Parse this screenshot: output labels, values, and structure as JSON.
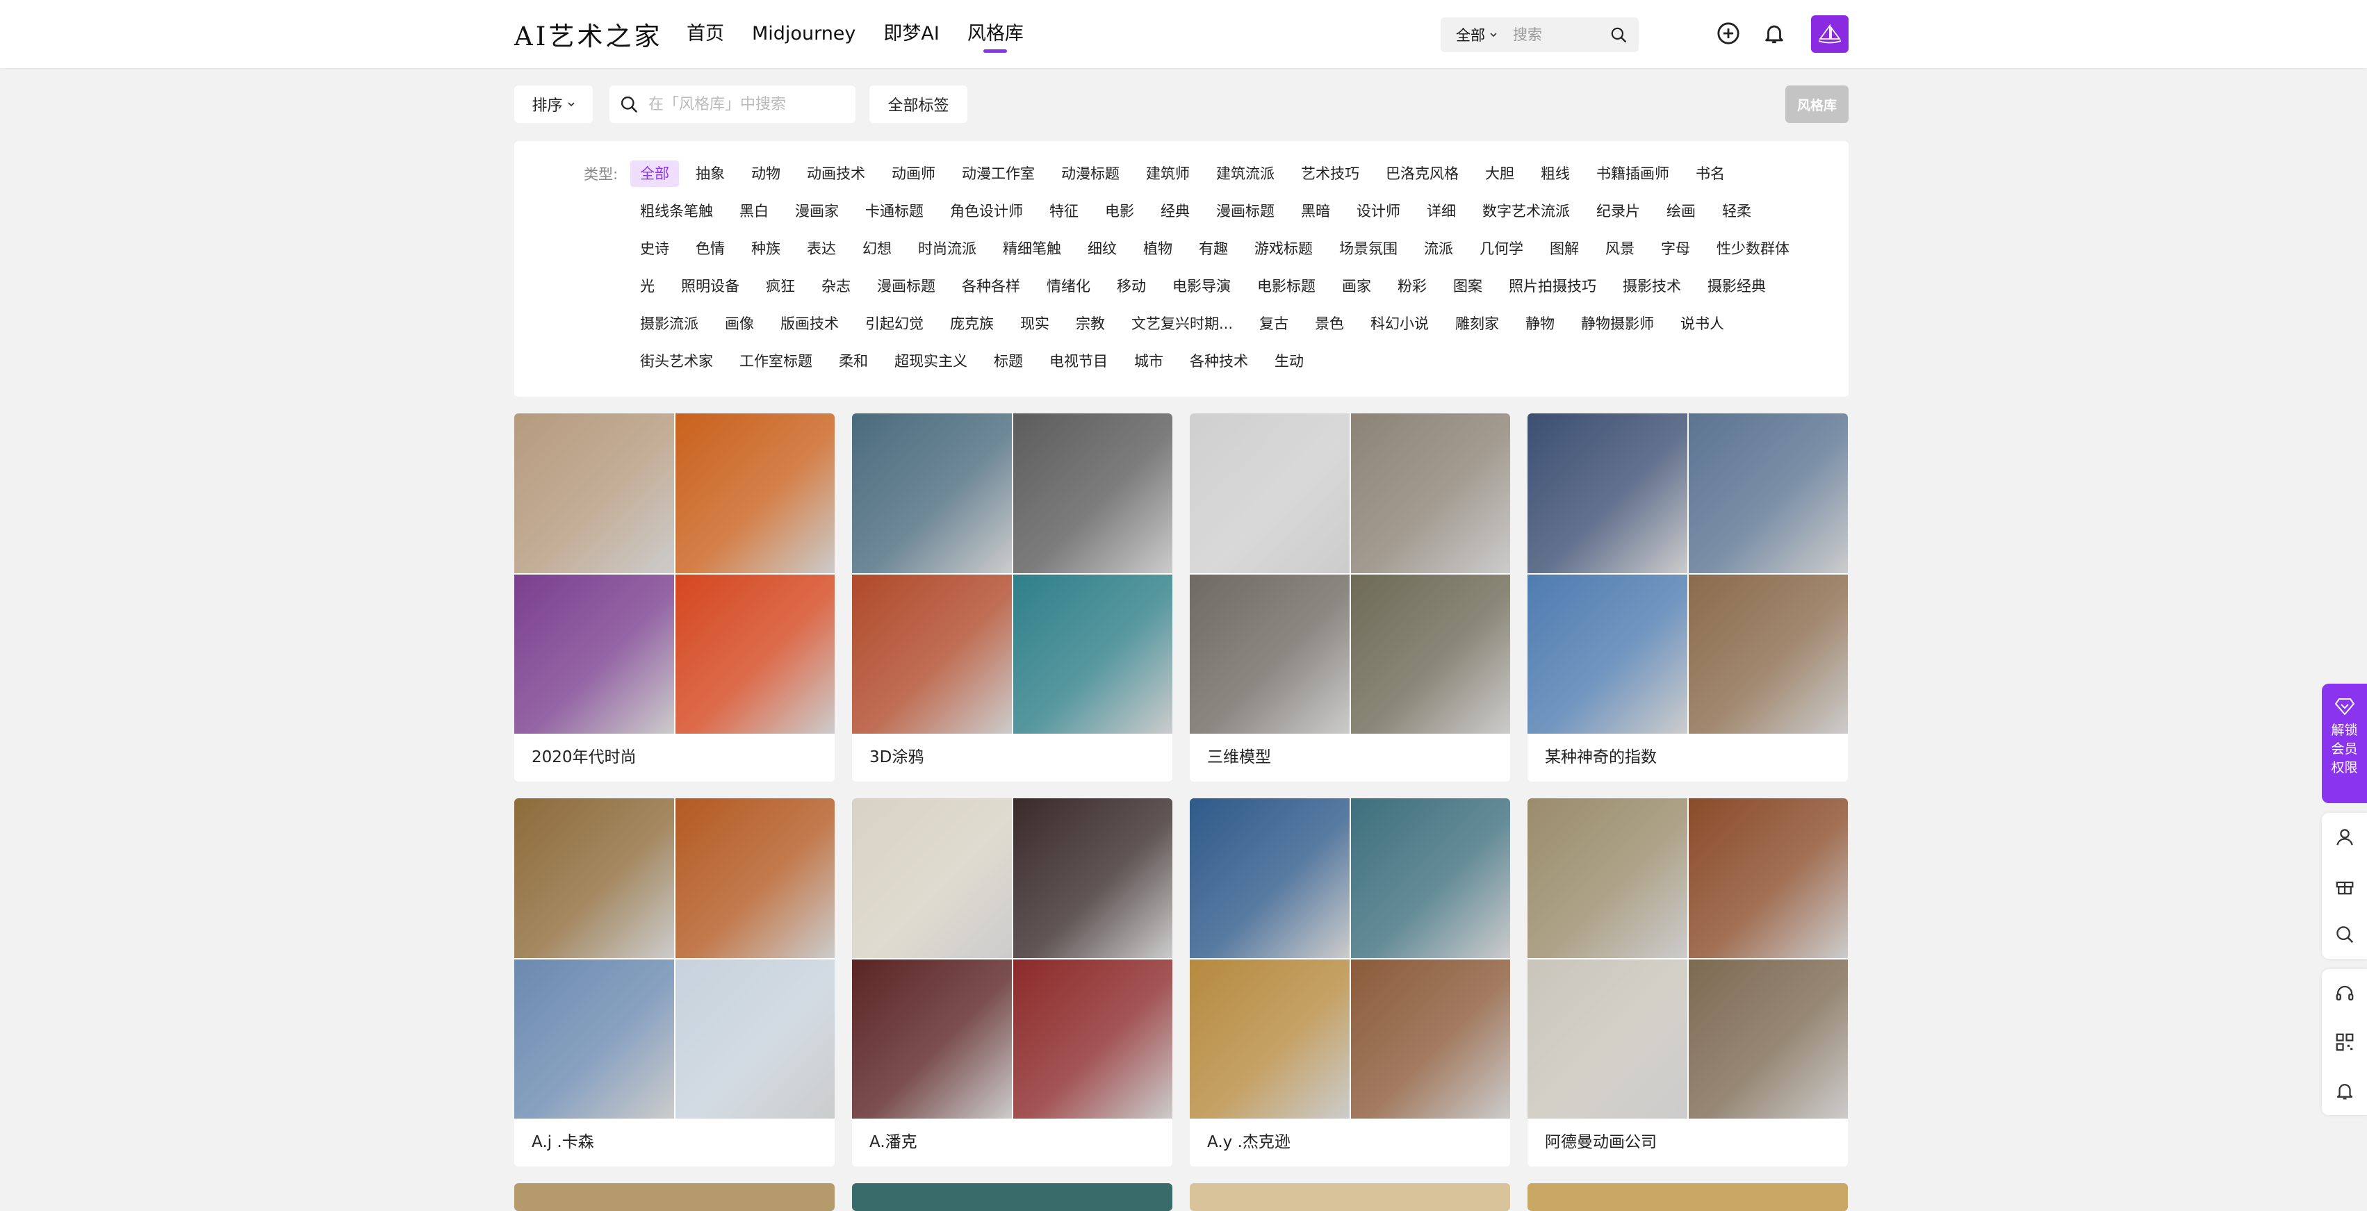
{
  "header": {
    "logo": "AI艺术之家",
    "nav": [
      "首页",
      "Midjourney",
      "即梦AI",
      "风格库"
    ],
    "active_nav": 3,
    "search_scope": "全部",
    "search_placeholder": "搜索"
  },
  "toolbar": {
    "sort_label": "排序",
    "filter_placeholder": "在「风格库」中搜索",
    "all_tags_label": "全部标签",
    "badge": "风格库"
  },
  "tags": {
    "label": "类型:",
    "items": [
      "全部",
      "抽象",
      "动物",
      "动画技术",
      "动画师",
      "动漫工作室",
      "动漫标题",
      "建筑师",
      "建筑流派",
      "艺术技巧",
      "巴洛克风格",
      "大胆",
      "粗线",
      "书籍插画师",
      "书名",
      "粗线条笔触",
      "黑白",
      "漫画家",
      "卡通标题",
      "角色设计师",
      "特征",
      "电影",
      "经典",
      "漫画标题",
      "黑暗",
      "设计师",
      "详细",
      "数字艺术流派",
      "纪录片",
      "绘画",
      "轻柔",
      "史诗",
      "色情",
      "种族",
      "表达",
      "幻想",
      "时尚流派",
      "精细笔触",
      "细纹",
      "植物",
      "有趣",
      "游戏标题",
      "场景氛围",
      "流派",
      "几何学",
      "图解",
      "风景",
      "字母",
      "性少数群体",
      "光",
      "照明设备",
      "疯狂",
      "杂志",
      "漫画标题",
      "各种各样",
      "情绪化",
      "移动",
      "电影导演",
      "电影标题",
      "画家",
      "粉彩",
      "图案",
      "照片拍摄技巧",
      "摄影技术",
      "摄影经典",
      "摄影流派",
      "画像",
      "版画技术",
      "引起幻觉",
      "庞克族",
      "现实",
      "宗教",
      "文艺复兴时期...",
      "复古",
      "景色",
      "科幻小说",
      "雕刻家",
      "静物",
      "静物摄影师",
      "说书人",
      "街头艺术家",
      "工作室标题",
      "柔和",
      "超现实主义",
      "标题",
      "电视节目",
      "城市",
      "各种技术",
      "生动"
    ]
  },
  "cards": [
    {
      "title": "2020年代时尚",
      "colors": [
        "#b59a7e",
        "#c9611c",
        "#7a3f8e",
        "#d4471f"
      ]
    },
    {
      "title": "3D涂鸦",
      "colors": [
        "#4a6b7d",
        "#5c5c5c",
        "#b04a2a",
        "#2f7f88"
      ]
    },
    {
      "title": "三维模型",
      "colors": [
        "#cfcfcf",
        "#8c8376",
        "#6f6a63",
        "#6e6a57"
      ]
    },
    {
      "title": "某种神奇的指数",
      "colors": [
        "#3c4f72",
        "#5b7491",
        "#4f7cb0",
        "#8a6b4c"
      ]
    },
    {
      "title": "A.j .卡森",
      "colors": [
        "#8d6b3a",
        "#b35a22",
        "#6b8ab0",
        "#c7d2dc"
      ]
    },
    {
      "title": "A.潘克",
      "colors": [
        "#d8d2c4",
        "#3a2b2b",
        "#5b2424",
        "#8c2a2a"
      ]
    },
    {
      "title": "A.y .杰克逊",
      "colors": [
        "#2f5a8a",
        "#3e6f7d",
        "#b68a3f",
        "#8b5b3a"
      ]
    },
    {
      "title": "阿德曼动画公司",
      "colors": [
        "#9a8c6b",
        "#8a4c2a",
        "#c9c5bb",
        "#7d6a52"
      ]
    }
  ],
  "partial_colors": [
    "#b59a6b",
    "#3a6b6b",
    "#d8c39a",
    "#c9a765"
  ],
  "sidebar": {
    "vip_label": "解锁会员权限",
    "icons": [
      "user-icon",
      "gift-icon",
      "search-icon",
      "headset-icon",
      "qrcode-icon",
      "bell-icon"
    ]
  }
}
